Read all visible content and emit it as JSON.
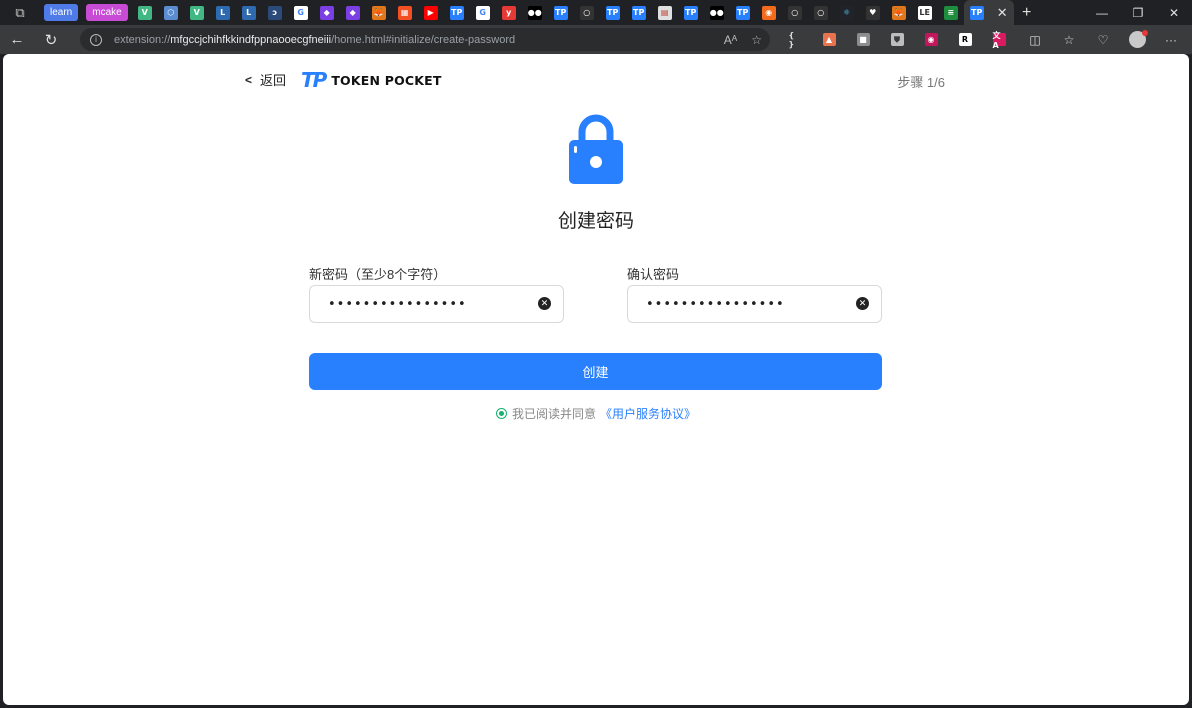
{
  "browser": {
    "tabs": [
      {
        "kind": "label",
        "text": "learn",
        "color": "#4f7be8"
      },
      {
        "kind": "label",
        "text": "mcake",
        "color": "#c84bd6"
      },
      {
        "kind": "icon",
        "glyph": "V",
        "color": "#41b883"
      },
      {
        "kind": "icon",
        "glyph": "⬡",
        "color": "#5b8bd0"
      },
      {
        "kind": "icon",
        "glyph": "V",
        "color": "#41b883"
      },
      {
        "kind": "icon",
        "glyph": "L",
        "color": "#2e6ab0"
      },
      {
        "kind": "icon",
        "glyph": "L",
        "color": "#2e6ab0"
      },
      {
        "kind": "icon",
        "glyph": "ↄ",
        "color": "#2b4a7a"
      },
      {
        "kind": "icon",
        "glyph": "G",
        "color": "#ffffff",
        "text_color": "#4285f4"
      },
      {
        "kind": "icon",
        "glyph": "◆",
        "color": "#7b3fe4"
      },
      {
        "kind": "icon",
        "glyph": "◆",
        "color": "#7b3fe4"
      },
      {
        "kind": "icon",
        "glyph": "🦊",
        "color": "#e2761b"
      },
      {
        "kind": "icon",
        "glyph": "▦",
        "color": "#f25022"
      },
      {
        "kind": "icon",
        "glyph": "▶",
        "color": "#ff0000"
      },
      {
        "kind": "icon",
        "glyph": "TP",
        "color": "#2980fe"
      },
      {
        "kind": "icon",
        "glyph": "G",
        "color": "#ffffff",
        "text_color": "#4285f4"
      },
      {
        "kind": "icon",
        "glyph": "y",
        "color": "#e53935"
      },
      {
        "kind": "icon",
        "glyph": "●●",
        "color": "#000000"
      },
      {
        "kind": "icon",
        "glyph": "TP",
        "color": "#2980fe"
      },
      {
        "kind": "icon",
        "glyph": "○",
        "color": "#333333"
      },
      {
        "kind": "icon",
        "glyph": "TP",
        "color": "#2980fe"
      },
      {
        "kind": "icon",
        "glyph": "TP",
        "color": "#2980fe"
      },
      {
        "kind": "icon",
        "glyph": "▤",
        "color": "#e0e0e0",
        "text_color": "#c0392b"
      },
      {
        "kind": "icon",
        "glyph": "TP",
        "color": "#2980fe"
      },
      {
        "kind": "icon",
        "glyph": "●●",
        "color": "#000000"
      },
      {
        "kind": "icon",
        "glyph": "TP",
        "color": "#2980fe"
      },
      {
        "kind": "icon",
        "glyph": "◉",
        "color": "#f26b1d"
      },
      {
        "kind": "icon",
        "glyph": "○",
        "color": "#333333"
      },
      {
        "kind": "icon",
        "glyph": "○",
        "color": "#333333"
      },
      {
        "kind": "icon",
        "glyph": "⚛",
        "color": "#20232a",
        "text_color": "#61dafb"
      },
      {
        "kind": "icon",
        "glyph": "♥",
        "color": "#333333"
      },
      {
        "kind": "icon",
        "glyph": "🦊",
        "color": "#e2761b"
      },
      {
        "kind": "icon",
        "glyph": "LE",
        "color": "#ffffff",
        "text_color": "#333333"
      },
      {
        "kind": "icon",
        "glyph": "≡",
        "color": "#1e8e3e"
      }
    ],
    "active_tab": {
      "glyph": "TP",
      "color": "#2980fe",
      "close": "✕"
    },
    "new_tab": "+",
    "address": {
      "scheme": "extension://",
      "host": "mfgccjchihfkkindfppnaooecgfneiii",
      "path": "/home.html#initialize/create-password"
    },
    "extensions": [
      {
        "glyph": "{ }",
        "color": "#3a3b3d",
        "text_color": "#dddddd"
      },
      {
        "glyph": "▲",
        "color": "#e8744f"
      },
      {
        "glyph": "■",
        "color": "#8d8d8d"
      },
      {
        "glyph": "⛊",
        "color": "#bdbdbd",
        "text_color": "#3a3b3d"
      },
      {
        "glyph": "◉",
        "color": "#c2185b"
      },
      {
        "glyph": "R",
        "color": "#ffffff",
        "text_color": "#000000"
      },
      {
        "glyph": "文A",
        "color": "#d81b60"
      }
    ]
  },
  "app": {
    "back_label": "返回",
    "logo_mark": "TP",
    "logo_text": "TOKEN POCKET",
    "step_label": "步骤 1/6",
    "title": "创建密码",
    "new_password": {
      "label": "新密码（至少8个字符）",
      "value": "••••••••••••••••"
    },
    "confirm_password": {
      "label": "确认密码",
      "value": "••••••••••••••••"
    },
    "create_button": "创建",
    "agreement_text": "我已阅读并同意",
    "agreement_link": "《用户服务协议》",
    "accent_color": "#2980fe"
  }
}
